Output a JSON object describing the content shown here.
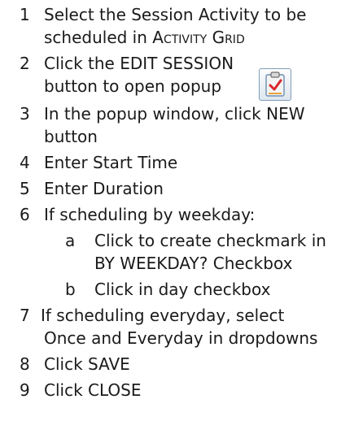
{
  "steps": [
    {
      "num": "1",
      "lines": [
        "Select the Session Activity to be",
        "scheduled in "
      ],
      "smallcaps": "Activity Grid"
    },
    {
      "num": "2",
      "lines": [
        "Click the EDIT SESSION",
        "button to open popup"
      ]
    },
    {
      "num": "3",
      "lines": [
        "In the popup window, click NEW",
        "button"
      ]
    },
    {
      "num": "4",
      "lines": [
        "Enter Start Time"
      ]
    },
    {
      "num": "5",
      "lines": [
        "Enter Duration"
      ]
    },
    {
      "num": "6",
      "lines": [
        "If scheduling by weekday:"
      ]
    },
    {
      "num": "7",
      "lines": [
        " If scheduling everyday, select",
        "Once and Everyday in dropdowns"
      ]
    },
    {
      "num": "8",
      "lines": [
        "Click SAVE"
      ]
    },
    {
      "num": "9",
      "lines": [
        "Click CLOSE"
      ]
    }
  ],
  "substeps": [
    {
      "letter": "a",
      "lines": [
        "Click to create checkmark in",
        "BY WEEKDAY? Checkbox"
      ]
    },
    {
      "letter": "b",
      "lines": [
        "Click in day checkbox"
      ]
    }
  ],
  "icons": {
    "edit_session": "edit-session-icon"
  }
}
